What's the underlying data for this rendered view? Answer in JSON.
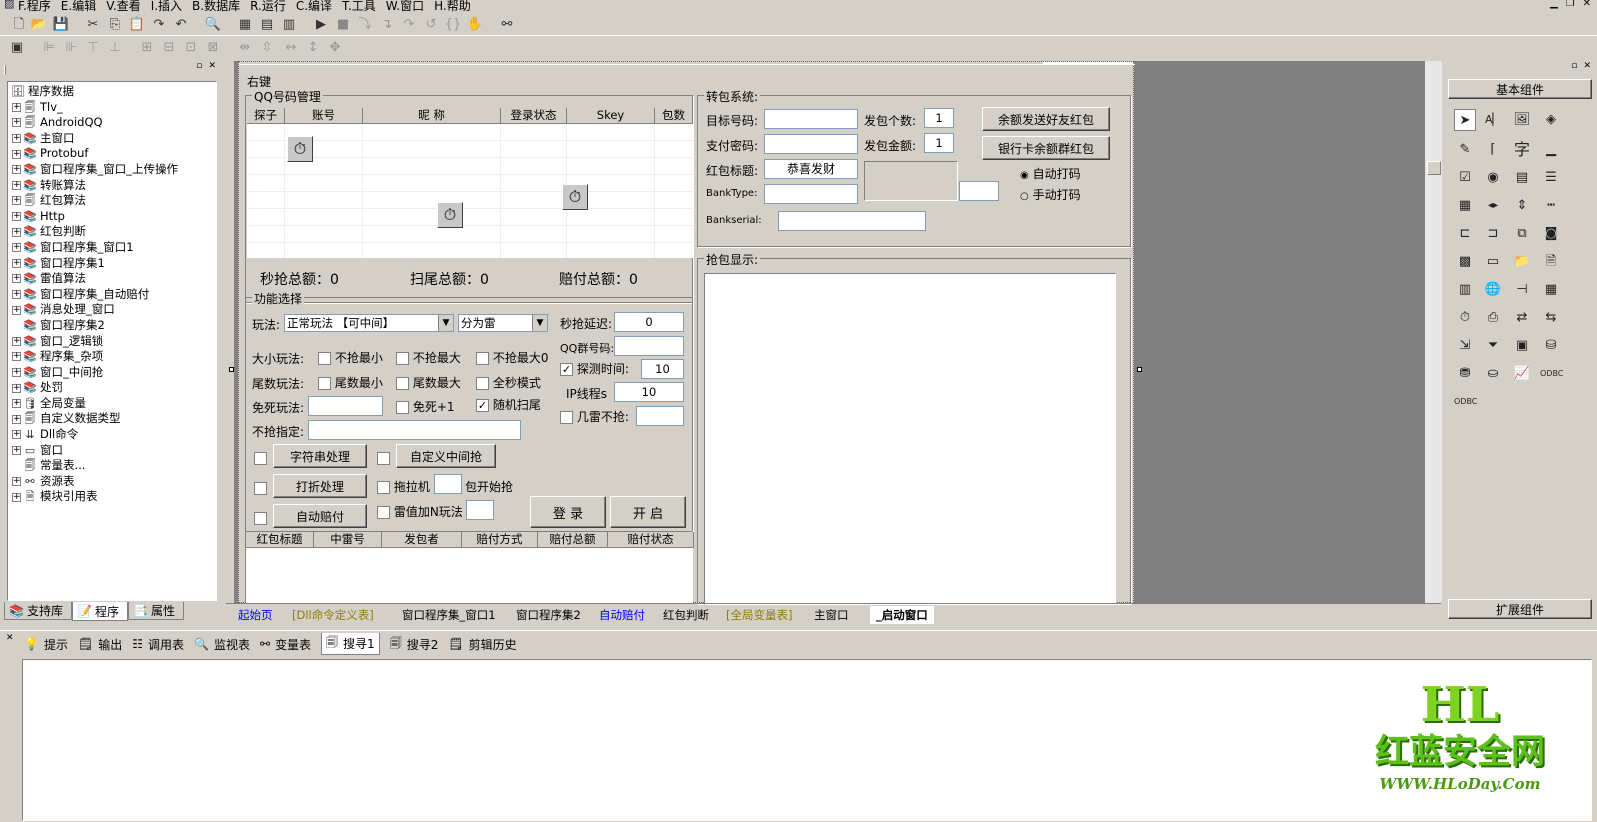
{
  "menu": [
    "F.程序",
    "E.编辑",
    "V.查看",
    "I.插入",
    "B.数据库",
    "R.运行",
    "C.编译",
    "T.工具",
    "W.窗口",
    "H.帮助"
  ],
  "tree": {
    "root": "程序数据",
    "items": [
      "Tlv_",
      "AndroidQQ",
      "主窗口",
      "Protobuf",
      "窗口程序集_窗口_上传操作",
      "转账算法",
      "红包算法",
      "Http",
      "红包判断",
      "窗口程序集_窗口1",
      "窗口程序集1",
      "雷值算法",
      "窗口程序集_自动赔付",
      "消息处理_窗口",
      "窗口程序集2",
      "窗口_逻辑锁",
      "程序集_杂项",
      "窗口_中间抢",
      "处罚",
      "全局变量",
      "自定义数据类型",
      "Dll命令",
      "窗口",
      "常量表...",
      "资源表",
      "模块引用表"
    ]
  },
  "left_tabs": [
    "支持库",
    "程序",
    "属性"
  ],
  "form": {
    "title": "右键",
    "qq_group": "QQ号码管理",
    "qq_cols": [
      "探子",
      "账号",
      "昵 称",
      "登录状态",
      "Skey",
      "包数"
    ],
    "totals": [
      "秒抢总额：0",
      "扫尾总额：0",
      "赔付总额：0"
    ],
    "func_group": "功能选择",
    "play_label": "玩法:",
    "play_value": "正常玩法 【可中间】",
    "split_value": "分为雷",
    "size_label": "大小玩法:",
    "size_opts": [
      "不抢最小",
      "不抢最大",
      "不抢最大0"
    ],
    "tail_label": "尾数玩法:",
    "tail_opts": [
      "尾数最小",
      "尾数最大",
      "全秒模式"
    ],
    "free_label": "免死玩法:",
    "free_opt": "免死+1",
    "random_opt": "随机扫尾",
    "noqiang_label": "不抢指定:",
    "btn_str": "字符串处理",
    "btn_custom": "自定义中间抢",
    "btn_discount": "打折处理",
    "tuoji": "拖拉机",
    "bao_start": "包开始抢",
    "btn_autopay": "自动赔付",
    "leizhi": "雷值加N玩法",
    "btn_login": "登 录",
    "btn_start": "开 启",
    "delay_label": "秒抢延迟:",
    "delay_value": "0",
    "qqgroup_label": "QQ群号码:",
    "detect_label": "探测时间:",
    "detect_value": "10",
    "ip_label": "IP线程s",
    "ip_value": "10",
    "jilei_label": "几雷不抢:",
    "pay_cols": [
      "红包标题",
      "中雷号",
      "发包者",
      "赔付方式",
      "赔付总额",
      "赔付状态"
    ],
    "transfer_group": "转包系统:",
    "target_label": "目标号码:",
    "paypwd_label": "支付密码:",
    "redtitle_label": "红包标题:",
    "redtitle_value": "恭喜发财",
    "banktype_label": "BankType:",
    "bankserial_label": "Bankserial:",
    "count_label": "发包个数:",
    "count_value": "1",
    "amount_label": "发包金额:",
    "amount_value": "1",
    "btn_balance": "余额发送好友红包",
    "btn_bankcard": "银行卡余额群红包",
    "auto_code": "自动打码",
    "manual_code": "手动打码",
    "grab_group": "抢包显示:"
  },
  "doc_tabs": [
    "起始页",
    "[Dll命令定义表]",
    "窗口程序集_窗口1",
    "窗口程序集2",
    "自动赔付",
    "红包判断",
    "[全局变量表]",
    "主窗口",
    "_启动窗口"
  ],
  "palette": {
    "top": "基本组件",
    "bottom": "扩展组件"
  },
  "bottom_tabs": [
    "提示",
    "输出",
    "调用表",
    "监视表",
    "变量表",
    "搜寻1",
    "搜寻2",
    "剪辑历史"
  ],
  "watermark": {
    "logo": "HL",
    "site": "红蓝安全网",
    "url": "WWW.HLoDay.Com"
  }
}
